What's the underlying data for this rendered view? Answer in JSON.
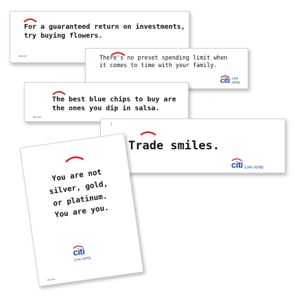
{
  "colors": {
    "arc_red": "#d6261f",
    "brand_blue": "#1b4aa0",
    "ink": "#111111"
  },
  "cards": [
    {
      "headline_lines": [
        "For a guaranteed return on investments,",
        "try buying flowers."
      ],
      "url": "citi.com"
    },
    {
      "headline_lines": [
        "There's no preset spending limit when",
        "it comes to time with your family."
      ],
      "brand": "citi",
      "tagline": "Live richly."
    },
    {
      "headline_lines": [
        "The best blue chips to buy are",
        "the ones you dip in salsa."
      ],
      "url": "citi.com"
    },
    {
      "headline_lines": [
        "Trade smiles."
      ],
      "brand": "citi",
      "tagline": "Live richly.",
      "page_mark": "1"
    },
    {
      "headline_lines": [
        "You are not",
        "silver, gold,",
        "or platinum.",
        "You are you."
      ],
      "brand": "citi",
      "tagline": "Live richly.",
      "url": "citi.com"
    }
  ]
}
